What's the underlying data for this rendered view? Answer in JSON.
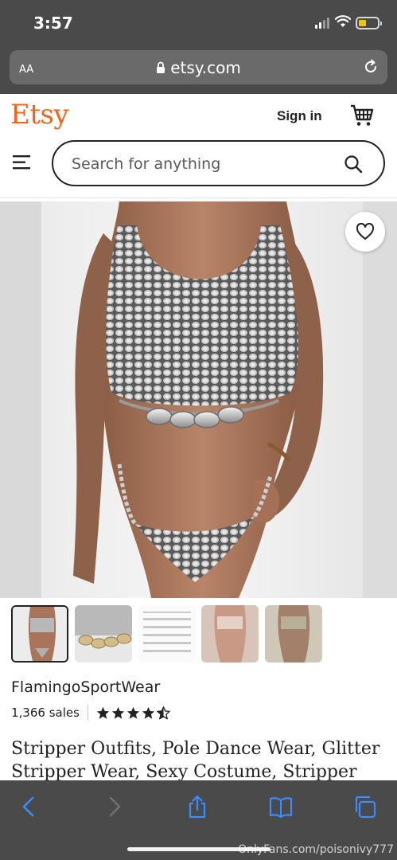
{
  "status_bar": {
    "time": "3:57",
    "battery_color": "#f3c400"
  },
  "browser": {
    "text_size_label": "AA",
    "url": "etsy.com",
    "toolbar_icons": [
      "back-icon",
      "forward-icon",
      "share-icon",
      "bookmarks-icon",
      "tabs-icon"
    ],
    "accent_color": "#3b8cff"
  },
  "header": {
    "logo": "Etsy",
    "logo_color": "#f1641e",
    "sign_in": "Sign in",
    "search_placeholder": "Search for anything"
  },
  "listing": {
    "shop_name": "FlamingoSportWear",
    "sales": "1,366 sales",
    "rating": 4.5,
    "rating_max": 5,
    "title": "Stripper Outfits, Pole Dance Wear, Glitter Stripper Wear, Sexy Costume, Stripper",
    "thumbnail_count": 5,
    "selected_thumbnail": 1
  },
  "watermark": "OnlyFans.com/poisonivy777"
}
